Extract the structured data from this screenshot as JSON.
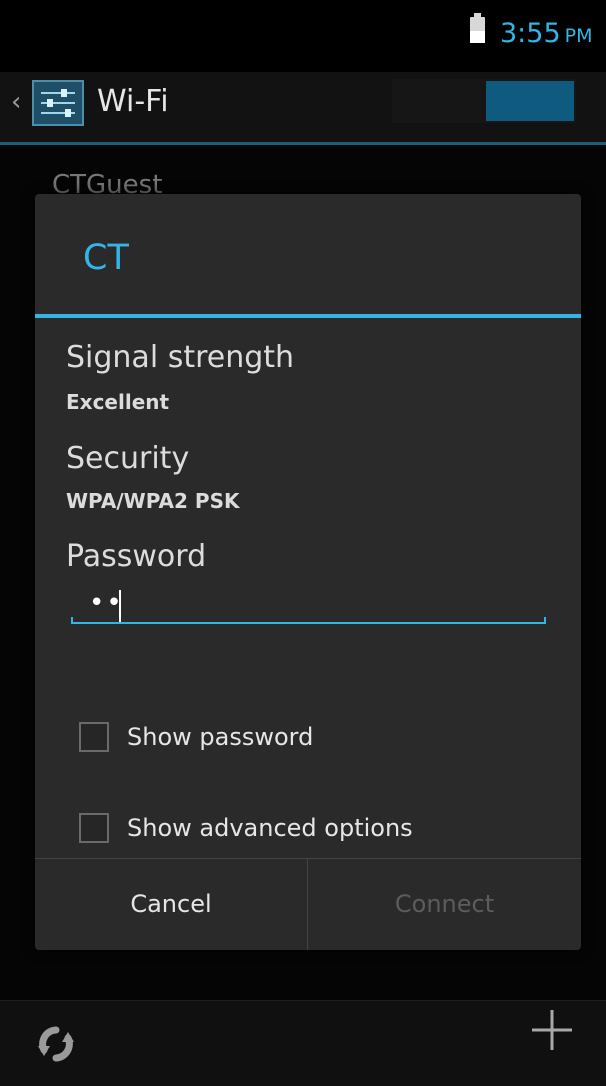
{
  "status_bar": {
    "time": "3:55",
    "ampm": "PM",
    "battery_icon": "battery-icon"
  },
  "action_bar": {
    "back_icon": "chevron-left-icon",
    "settings_icon": "settings-sliders-icon",
    "title": "Wi-Fi"
  },
  "background_list": {
    "item_label": "CTGuest"
  },
  "dialog": {
    "title": "CT",
    "signal_label": "Signal strength",
    "signal_value": "Excellent",
    "security_label": "Security",
    "security_value": "WPA/WPA2 PSK",
    "password_label": "Password",
    "password_value": "••",
    "show_password_label": "Show password",
    "show_advanced_label": "Show advanced options",
    "cancel_label": "Cancel",
    "connect_label": "Connect"
  },
  "bottom_bar": {
    "wps_icon": "wps-icon",
    "add_icon": "add-icon"
  },
  "colors": {
    "accent": "#33b5e5",
    "background": "#050505",
    "dialog": "#2a2a2a",
    "text": "#e6e6e6",
    "disabled_text": "#5c5c5c"
  }
}
